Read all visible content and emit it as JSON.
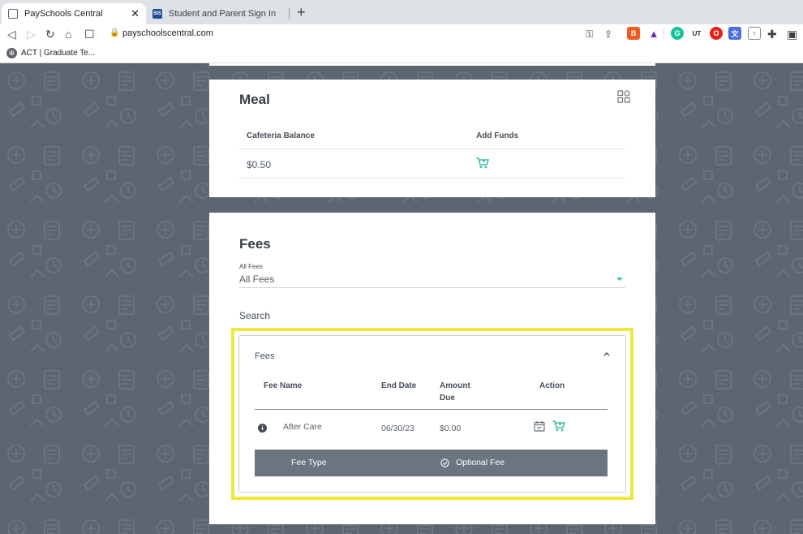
{
  "browser": {
    "tabs": [
      {
        "label": "PaySchools Central",
        "active": true
      },
      {
        "label": "Student and Parent Sign In",
        "active": false,
        "favicon_text": "SIS"
      }
    ],
    "url": "payschoolscentral.com",
    "bookmark": "ACT | Graduate Te..."
  },
  "meal": {
    "title": "Meal",
    "col_balance": "Cafeteria Balance",
    "col_add": "Add Funds",
    "balance": "$0.50"
  },
  "fees": {
    "title": "Fees",
    "filter_label": "All Fees",
    "filter_value": "All Fees",
    "search_label": "Search",
    "panel": {
      "title": "Fees",
      "headers": {
        "name": "Fee Name",
        "end_date": "End Date",
        "amount_due_1": "Amount",
        "amount_due_2": "Due",
        "action": "Action"
      },
      "rows": [
        {
          "name": "After Care",
          "end_date": "06/30/23",
          "amount_due": "$0.00"
        }
      ],
      "detail": {
        "label": "Fee Type",
        "value": "Optional Fee"
      }
    }
  },
  "colors": {
    "accent": "#3dbfa6",
    "highlight": "#eee83a",
    "background": "#5d6670"
  }
}
